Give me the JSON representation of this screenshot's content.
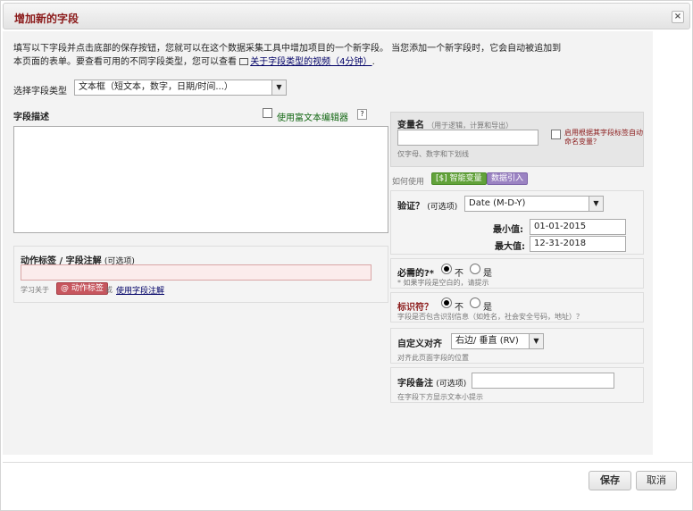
{
  "dialog": {
    "title": "增加新的字段",
    "close_symbol": "×"
  },
  "intro": {
    "line1": "填写以下字段并点击底部的保存按钮，您就可以在这个数据采集工具中增加项目的一个新字段。 当您添加一个新字段时，它会自动被追加到",
    "line2_prefix": "本页面的表单。要查看可用的不同字段类型，您可以查看 ",
    "video_link": "关于字段类型的视频（4分钟）",
    "line2_suffix": "."
  },
  "field_type": {
    "label": "选择字段类型",
    "value": "文本框（短文本，数字，日期/时间...）"
  },
  "description": {
    "label": "字段描述",
    "rich_text_label": "使用富文本编辑器",
    "help": "?",
    "value": ""
  },
  "action_tags": {
    "label": "动作标签 / 字段注解",
    "optional": "(可选项)",
    "value": "",
    "learn_prefix": "学习关于",
    "tag_button": "@ 动作标签",
    "or": "或",
    "annotation_link": "使用字段注解"
  },
  "variable": {
    "label": "变量名",
    "hint": "（用于逻辑，计算和导出）",
    "value": "",
    "note": "仅字母、数字和下划线",
    "auto_name_label": "启用根据其字段标签自动命名变量？"
  },
  "howto": {
    "label": "如何使用",
    "smart_vars": "[$] 智能变量",
    "piping": "数据引入"
  },
  "validation": {
    "label": "验证？",
    "optional": "(可选项)",
    "value": "Date (M-D-Y)",
    "min_label": "最小值:",
    "min_value": "01-01-2015",
    "max_label": "最大值:",
    "max_value": "12-31-2018"
  },
  "required": {
    "label": "必需的?*",
    "no": "不",
    "yes": "是",
    "selected": "no",
    "note": "* 如果字段是空白的，请提示"
  },
  "identifier": {
    "label": "标识符？",
    "no": "不",
    "yes": "是",
    "selected": "no",
    "note": "字段是否包含识别信息（如姓名，社会安全号码，地址）？"
  },
  "alignment": {
    "label": "自定义对齐",
    "value": "右边/ 垂直 (RV)",
    "note": "对齐此页面字段的位置"
  },
  "field_note": {
    "label": "字段备注",
    "optional": "(可选项)",
    "value": "",
    "note": "在字段下方显示文本小提示"
  },
  "footer": {
    "save": "保存",
    "cancel": "取消"
  },
  "colors": {
    "title": "#8b1a1a",
    "smart_var_green": "#62a23a",
    "piping_purple": "#9b83c2",
    "action_tag_red": "#c7565e"
  }
}
